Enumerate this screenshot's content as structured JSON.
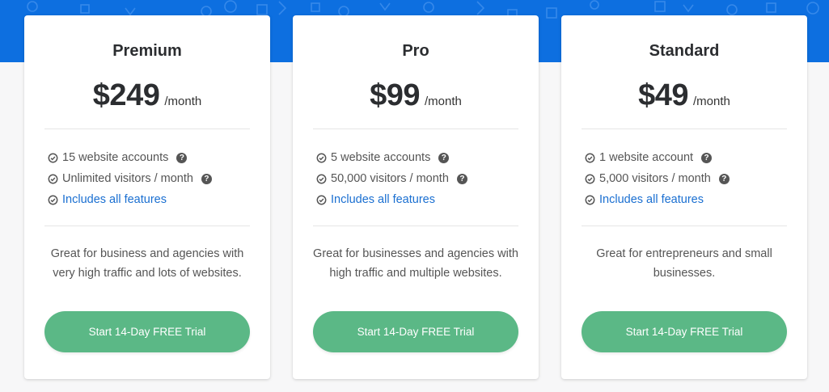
{
  "colors": {
    "hero_background": "#0d6fe0",
    "cta_button": "#5bb886",
    "link_text": "#1a6fd1",
    "page_background": "#f7f7f8"
  },
  "icons": {
    "feature_bullet": "circle-check-icon",
    "feature_help": "question-circle-icon",
    "hero_pattern": "geometric-shapes-pattern"
  },
  "plans": [
    {
      "name": "Premium",
      "price": "$249",
      "period": "/month",
      "features": [
        {
          "text": "15 website accounts",
          "help": "?"
        },
        {
          "text": "Unlimited visitors / month",
          "help": "?"
        },
        {
          "text": "Includes all features"
        }
      ],
      "description": "Great for business and agencies with very high traffic and lots of websites.",
      "cta": "Start 14-Day FREE Trial"
    },
    {
      "name": "Pro",
      "price": "$99",
      "period": "/month",
      "features": [
        {
          "text": "5 website accounts",
          "help": "?"
        },
        {
          "text": "50,000 visitors / month",
          "help": "?"
        },
        {
          "text": "Includes all features"
        }
      ],
      "description": "Great for businesses and agencies with high traffic and multiple websites.",
      "cta": "Start 14-Day FREE Trial"
    },
    {
      "name": "Standard",
      "price": "$49",
      "period": "/month",
      "features": [
        {
          "text": "1 website account",
          "help": "?"
        },
        {
          "text": "5,000 visitors / month",
          "help": "?"
        },
        {
          "text": "Includes all features"
        }
      ],
      "description": "Great for entrepreneurs and small businesses.",
      "cta": "Start 14-Day FREE Trial"
    }
  ]
}
